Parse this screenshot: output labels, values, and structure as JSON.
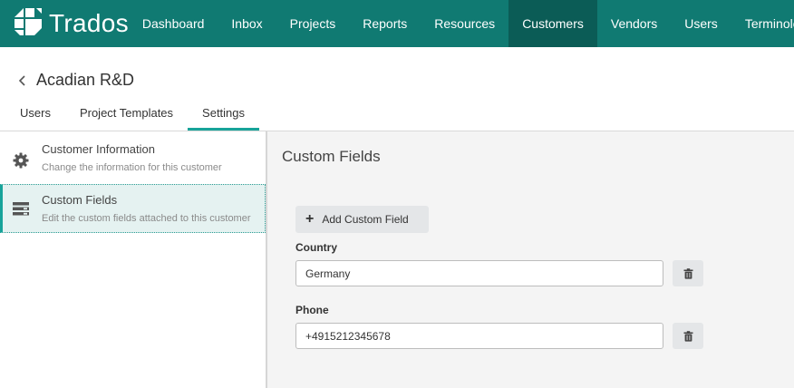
{
  "app": {
    "brand": "Trados"
  },
  "nav": {
    "items": [
      {
        "label": "Dashboard"
      },
      {
        "label": "Inbox"
      },
      {
        "label": "Projects"
      },
      {
        "label": "Reports"
      },
      {
        "label": "Resources"
      },
      {
        "label": "Customers",
        "active": true
      },
      {
        "label": "Vendors"
      },
      {
        "label": "Users"
      },
      {
        "label": "Terminology"
      }
    ]
  },
  "header": {
    "title": "Acadian R&D",
    "tabs": [
      {
        "label": "Users"
      },
      {
        "label": "Project Templates"
      },
      {
        "label": "Settings",
        "active": true
      }
    ]
  },
  "sidebar": {
    "items": [
      {
        "title": "Customer Information",
        "description": "Change the information for this customer",
        "icon": "gear-icon"
      },
      {
        "title": "Custom Fields",
        "description": "Edit the custom fields attached to this customer",
        "icon": "fields-icon",
        "selected": true
      }
    ]
  },
  "main": {
    "title": "Custom Fields",
    "add_label": "Add Custom Field",
    "fields": [
      {
        "label": "Country",
        "value": "Germany"
      },
      {
        "label": "Phone",
        "value": "+4915212345678"
      }
    ]
  },
  "colors": {
    "topbar": "#107a72",
    "active_nav": "#0b5c56",
    "accent": "#17a39a",
    "selected_bg": "#e5f2f1"
  }
}
